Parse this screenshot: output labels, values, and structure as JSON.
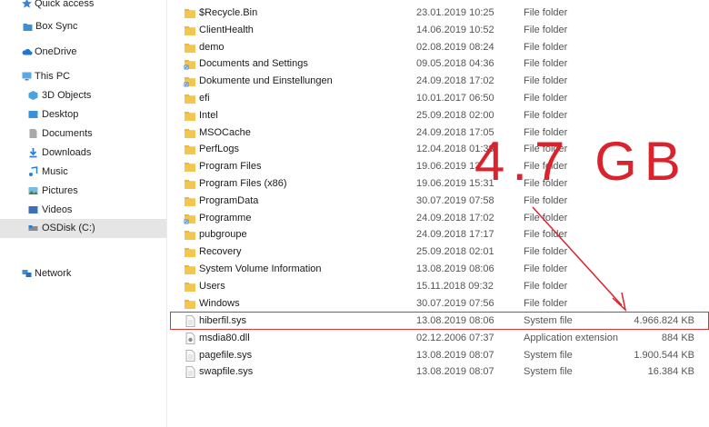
{
  "sidebar": {
    "items": [
      {
        "label": "Quick access",
        "icon": "star-icon"
      },
      {
        "label": "Box Sync",
        "icon": "box-sync-icon"
      },
      {
        "label": "OneDrive",
        "icon": "cloud-icon"
      },
      {
        "label": "This PC",
        "icon": "computer-icon"
      },
      {
        "label": "3D Objects",
        "icon": "cube-icon"
      },
      {
        "label": "Desktop",
        "icon": "desktop-icon"
      },
      {
        "label": "Documents",
        "icon": "document-icon"
      },
      {
        "label": "Downloads",
        "icon": "download-icon"
      },
      {
        "label": "Music",
        "icon": "music-icon"
      },
      {
        "label": "Pictures",
        "icon": "pictures-icon"
      },
      {
        "label": "Videos",
        "icon": "video-icon"
      },
      {
        "label": "OSDisk (C:)",
        "icon": "disk-icon"
      },
      {
        "label": "Network",
        "icon": "network-icon"
      }
    ]
  },
  "files": [
    {
      "name": "$Recycle.Bin",
      "date": "23.01.2019 10:25",
      "type": "File folder",
      "size": "",
      "icon": "folder-icon"
    },
    {
      "name": "ClientHealth",
      "date": "14.06.2019 10:52",
      "type": "File folder",
      "size": "",
      "icon": "folder-icon"
    },
    {
      "name": "demo",
      "date": "02.08.2019 08:24",
      "type": "File folder",
      "size": "",
      "icon": "folder-icon"
    },
    {
      "name": "Documents and Settings",
      "date": "09.05.2018 04:36",
      "type": "File folder",
      "size": "",
      "icon": "folder-shortcut-icon"
    },
    {
      "name": "Dokumente und Einstellungen",
      "date": "24.09.2018 17:02",
      "type": "File folder",
      "size": "",
      "icon": "folder-shortcut-icon"
    },
    {
      "name": "efi",
      "date": "10.01.2017 06:50",
      "type": "File folder",
      "size": "",
      "icon": "folder-icon"
    },
    {
      "name": "Intel",
      "date": "25.09.2018 02:00",
      "type": "File folder",
      "size": "",
      "icon": "folder-icon"
    },
    {
      "name": "MSOCache",
      "date": "24.09.2018 17:05",
      "type": "File folder",
      "size": "",
      "icon": "folder-icon"
    },
    {
      "name": "PerfLogs",
      "date": "12.04.2018 01:38",
      "type": "File folder",
      "size": "",
      "icon": "folder-icon"
    },
    {
      "name": "Program Files",
      "date": "19.06.2019 13:",
      "type": "File folder",
      "size": "",
      "icon": "folder-icon"
    },
    {
      "name": "Program Files (x86)",
      "date": "19.06.2019 15:31",
      "type": "File folder",
      "size": "",
      "icon": "folder-icon"
    },
    {
      "name": "ProgramData",
      "date": "30.07.2019 07:58",
      "type": "File folder",
      "size": "",
      "icon": "folder-icon"
    },
    {
      "name": "Programme",
      "date": "24.09.2018 17:02",
      "type": "File folder",
      "size": "",
      "icon": "folder-shortcut-icon"
    },
    {
      "name": "pubgroupe",
      "date": "24.09.2018 17:17",
      "type": "File folder",
      "size": "",
      "icon": "folder-icon"
    },
    {
      "name": "Recovery",
      "date": "25.09.2018 02:01",
      "type": "File folder",
      "size": "",
      "icon": "folder-icon"
    },
    {
      "name": "System Volume Information",
      "date": "13.08.2019 08:06",
      "type": "File folder",
      "size": "",
      "icon": "folder-icon"
    },
    {
      "name": "Users",
      "date": "15.11.2018 09:32",
      "type": "File folder",
      "size": "",
      "icon": "folder-icon"
    },
    {
      "name": "Windows",
      "date": "30.07.2019 07:56",
      "type": "File folder",
      "size": "",
      "icon": "folder-icon"
    },
    {
      "name": "hiberfil.sys",
      "date": "13.08.2019 08:06",
      "type": "System file",
      "size": "4.966.824 KB",
      "icon": "system-file-icon"
    },
    {
      "name": "msdia80.dll",
      "date": "02.12.2006 07:37",
      "type": "Application extension",
      "size": "884 KB",
      "icon": "dll-file-icon"
    },
    {
      "name": "pagefile.sys",
      "date": "13.08.2019 08:07",
      "type": "System file",
      "size": "1.900.544 KB",
      "icon": "system-file-icon"
    },
    {
      "name": "swapfile.sys",
      "date": "13.08.2019 08:07",
      "type": "System file",
      "size": "16.384 KB",
      "icon": "system-file-icon"
    }
  ],
  "annotation": {
    "text": "4.7 GB",
    "color": "#d9232d"
  },
  "colors": {
    "folder": "#e8b73c",
    "selected_bg": "#e5e5e5",
    "highlight": "#d8363a"
  }
}
